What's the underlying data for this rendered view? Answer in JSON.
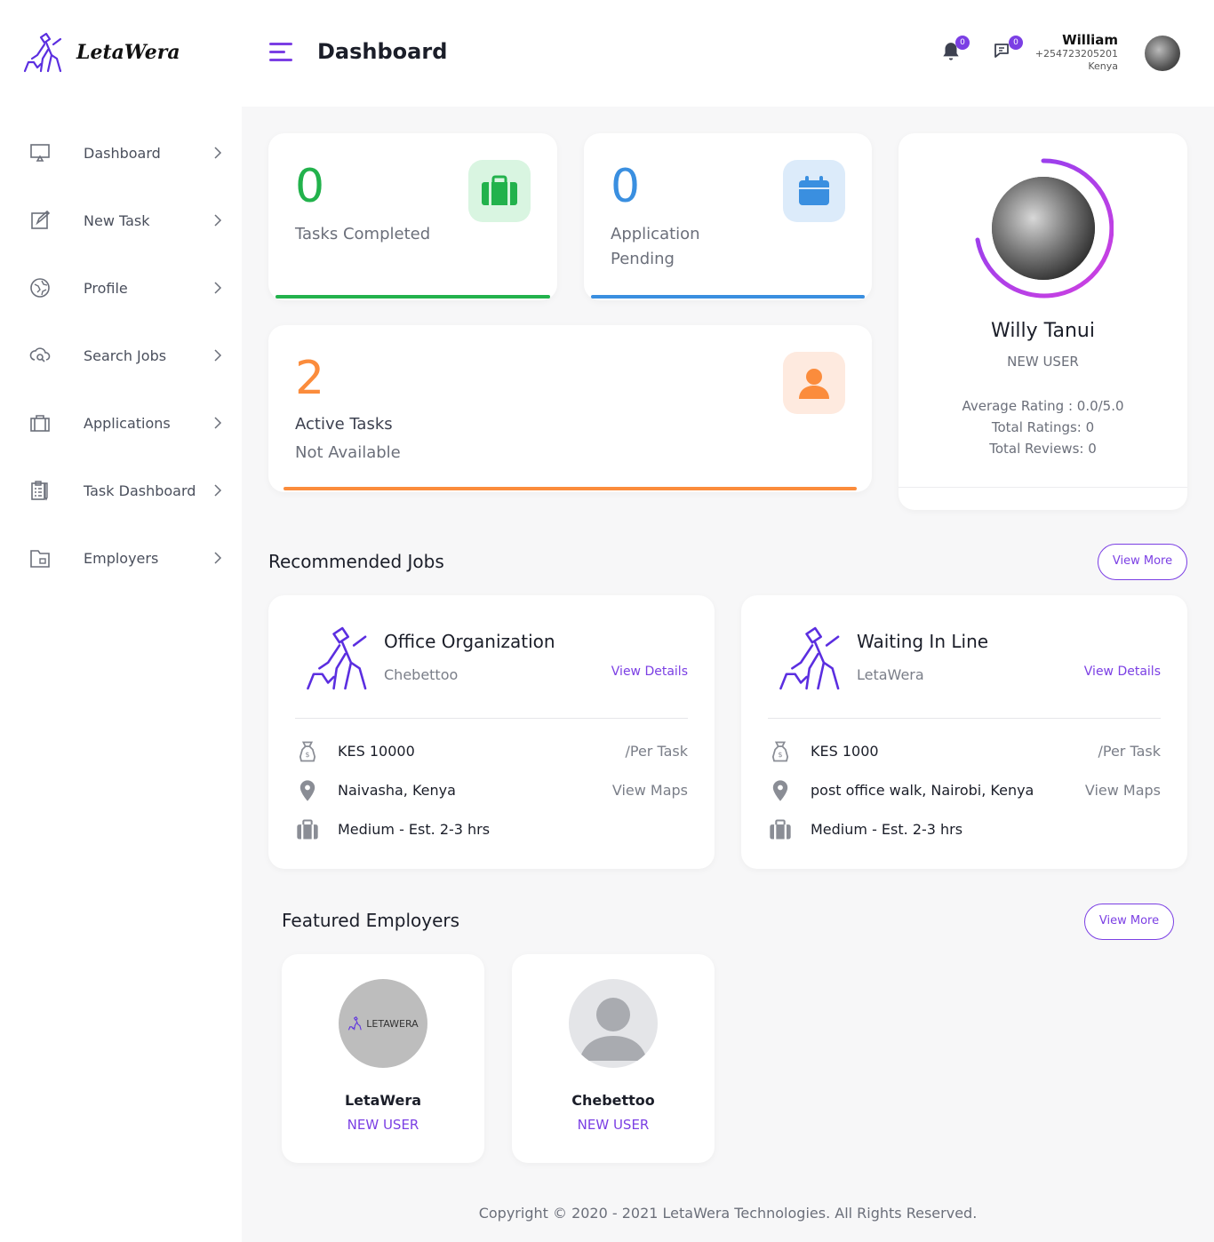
{
  "brand": {
    "name": "LetaWera"
  },
  "header": {
    "title": "Dashboard",
    "notifications_count": "0",
    "messages_count": "0",
    "user": {
      "name": "William",
      "phone": "+254723205201",
      "country": "Kenya"
    }
  },
  "sidebar": {
    "items": [
      {
        "label": "Dashboard",
        "icon": "monitor-icon"
      },
      {
        "label": "New Task",
        "icon": "edit-icon"
      },
      {
        "label": "Profile",
        "icon": "globe-icon"
      },
      {
        "label": "Search Jobs",
        "icon": "search-cloud-icon"
      },
      {
        "label": "Applications",
        "icon": "briefcase-icon"
      },
      {
        "label": "Task Dashboard",
        "icon": "clipboard-icon"
      },
      {
        "label": "Employers",
        "icon": "folder-icon"
      }
    ]
  },
  "stats": {
    "tasks_completed": {
      "value": "0",
      "label": "Tasks Completed",
      "color": "#22b24c"
    },
    "application_pending": {
      "value": "0",
      "label": "Application Pending",
      "color": "#3a8fe0"
    },
    "active_tasks": {
      "value": "2",
      "label": "Active Tasks",
      "sublabel": "Not Available",
      "color": "#fb8c3c"
    }
  },
  "profile_card": {
    "name": "Willy Tanui",
    "role": "NEW USER",
    "average_rating": "Average Rating : 0.0/5.0",
    "total_ratings": "Total Ratings: 0",
    "total_reviews": "Total Reviews: 0"
  },
  "recommended_jobs": {
    "title": "Recommended Jobs",
    "view_more": "View More",
    "jobs": [
      {
        "title": "Office Organization",
        "company": "Chebettoo",
        "view_details": "View Details",
        "pay": "KES 10000",
        "pay_unit": "/Per Task",
        "location": "Naivasha, Kenya",
        "view_maps": "View Maps",
        "effort": "Medium - Est. 2-3 hrs"
      },
      {
        "title": "Waiting In Line",
        "company": "LetaWera",
        "view_details": "View Details",
        "pay": "KES 1000",
        "pay_unit": "/Per Task",
        "location": "post office walk, Nairobi, Kenya",
        "view_maps": "View Maps",
        "effort": "Medium - Est. 2-3 hrs"
      }
    ]
  },
  "featured_employers": {
    "title": "Featured Employers",
    "view_more": "View More",
    "employers": [
      {
        "name": "LetaWera",
        "role": "NEW USER",
        "logo_text": "LETAWERA"
      },
      {
        "name": "Chebettoo",
        "role": "NEW USER"
      }
    ]
  },
  "footer": {
    "copyright": "Copyright © 2020 - 2021 LetaWera Technologies. All Rights Reserved."
  },
  "colors": {
    "accent": "#7b3fe4",
    "green": "#22b24c",
    "blue": "#3a8fe0",
    "orange": "#fb8c3c"
  }
}
